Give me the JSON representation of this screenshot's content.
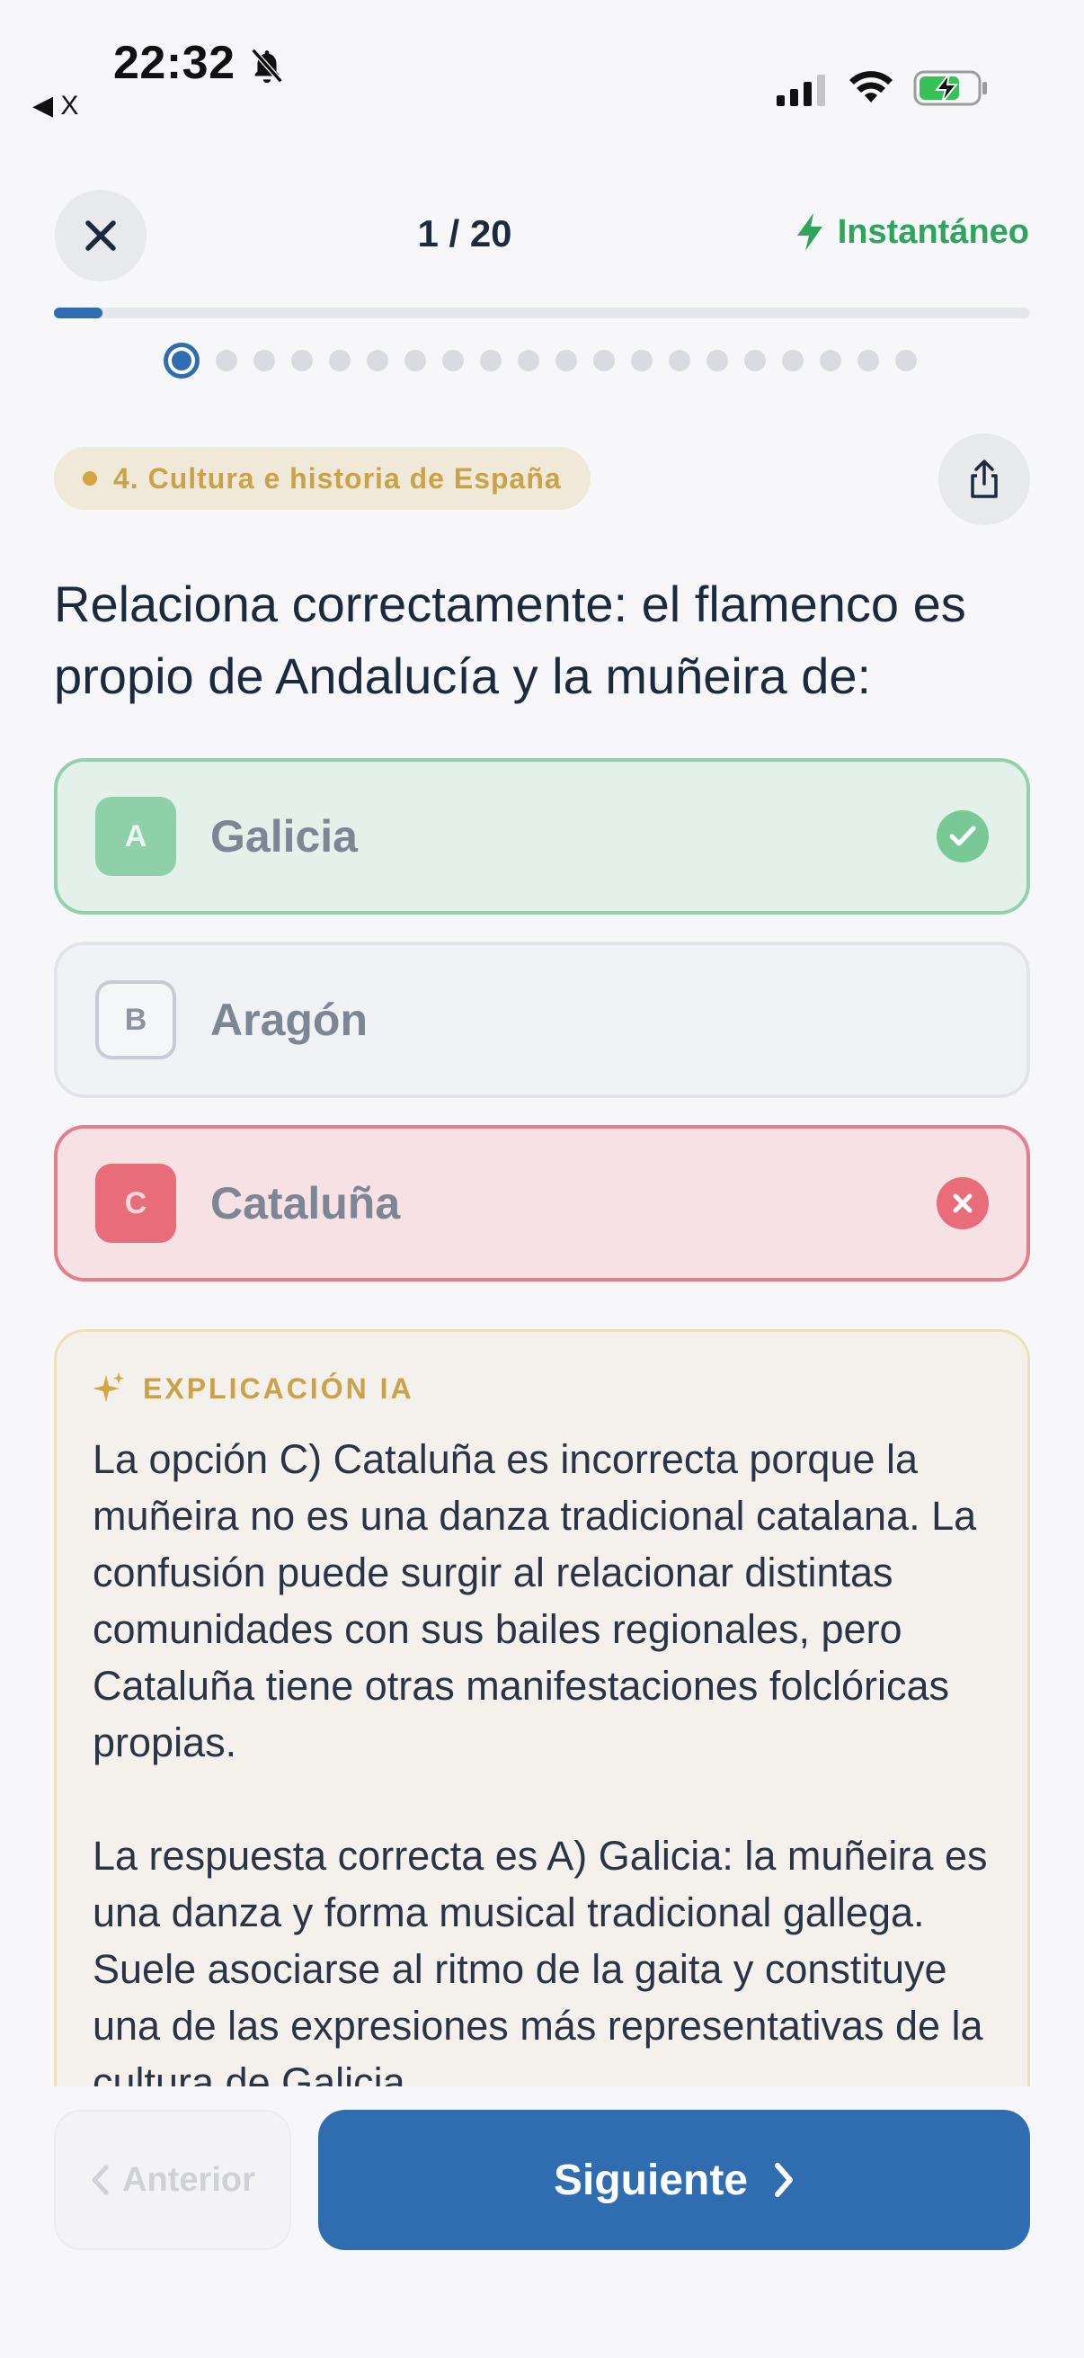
{
  "status_bar": {
    "time": "22:32",
    "back_app": "◀ X",
    "icons": [
      "bell-slash-icon",
      "signal-icon",
      "wifi-icon",
      "battery-charging-icon"
    ]
  },
  "header": {
    "close_icon": "close-icon",
    "counter": "1 / 20",
    "mode_icon": "lightning-icon",
    "mode_label": "Instantáneo",
    "progress_fraction": 0.05,
    "total_questions": 20,
    "current_question": 1
  },
  "category": {
    "label": "4. Cultura e historia de España",
    "share_icon": "share-icon"
  },
  "question": {
    "text": "Relaciona correctamente: el flamenco es propio de Andalucía y la muñeira de:"
  },
  "options": [
    {
      "letter": "A",
      "text": "Galicia",
      "state": "correct",
      "mark_icon": "check-icon"
    },
    {
      "letter": "B",
      "text": "Aragón",
      "state": "neutral"
    },
    {
      "letter": "C",
      "text": "Cataluña",
      "state": "incorrect",
      "mark_icon": "x-icon"
    }
  ],
  "explanation": {
    "icon": "sparkles-icon",
    "title": "EXPLICACIÓN IA",
    "paragraphs": [
      "La opción C) Cataluña es incorrecta porque la muñeira no es una danza tradicional catalana. La confusión puede surgir al relacionar distintas comunidades con sus bailes regionales, pero Cataluña tiene otras manifestaciones folclóricas propias.",
      "La respuesta correcta es A) Galicia: la muñeira es una danza y forma musical tradicional gallega. Suele asociarse al ritmo de la gaita y constituye una de las expresiones más representativas de la cultura de Galicia."
    ]
  },
  "footer": {
    "prev_label": "Anterior",
    "next_label": "Siguiente"
  },
  "colors": {
    "primary": "#2f6db0",
    "correct": "#79c996",
    "incorrect": "#e86c7a",
    "accent_gold": "#c9a24a",
    "instant_green": "#2ea45c"
  }
}
